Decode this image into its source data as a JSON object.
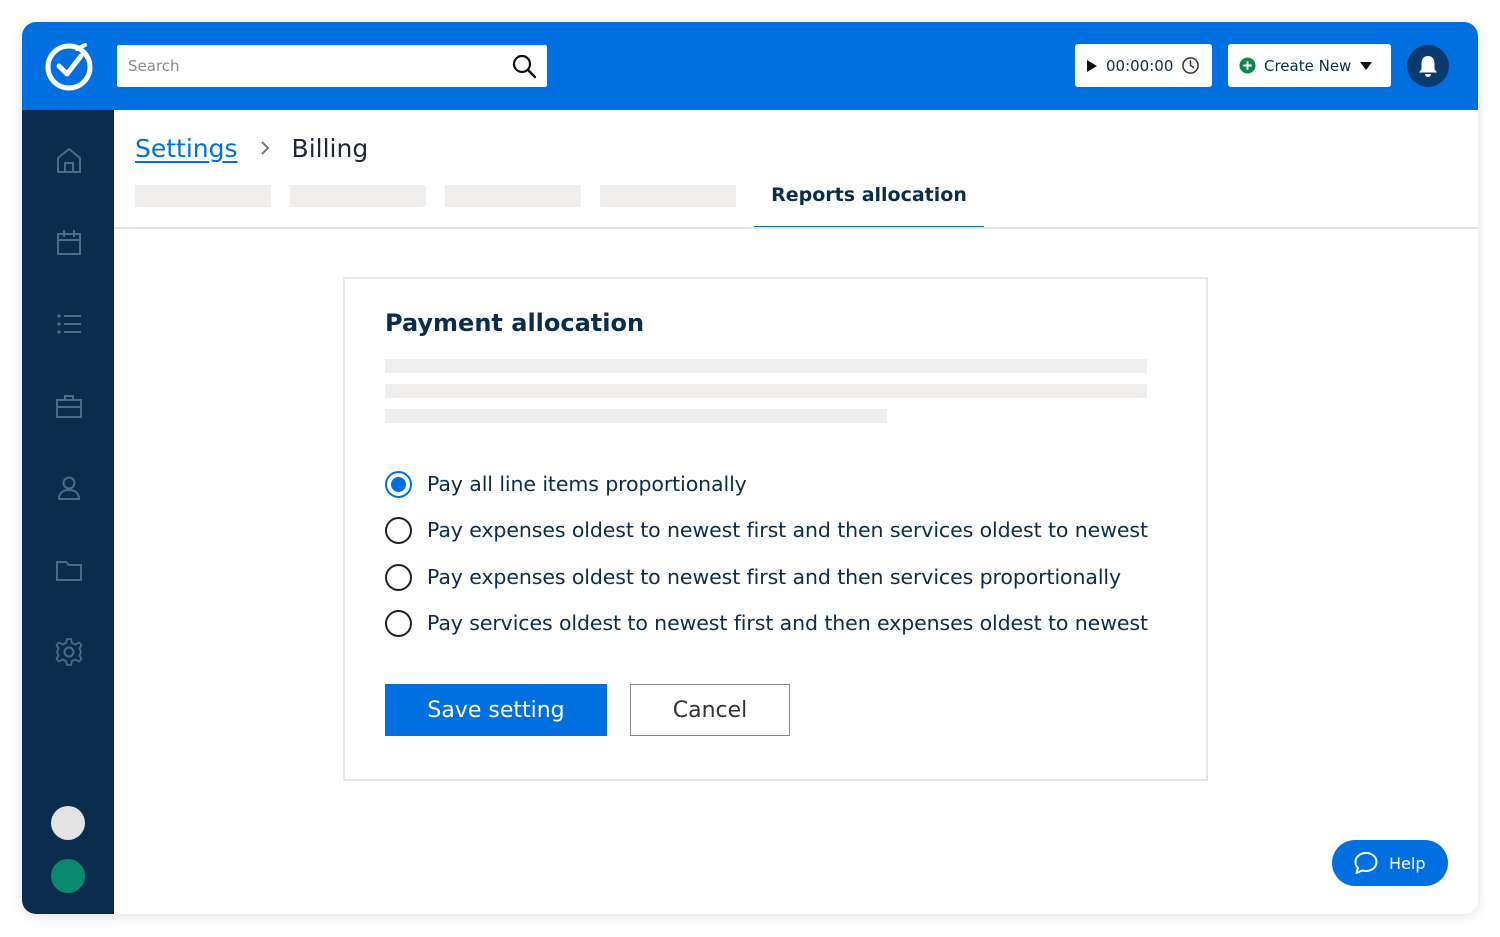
{
  "header": {
    "search_placeholder": "Search",
    "timer_value": "00:00:00",
    "create_new_label": "Create New"
  },
  "sidebar": {
    "items": [
      {
        "icon": "home-icon"
      },
      {
        "icon": "calendar-icon"
      },
      {
        "icon": "list-icon"
      },
      {
        "icon": "briefcase-icon"
      },
      {
        "icon": "person-icon"
      },
      {
        "icon": "folder-icon"
      },
      {
        "icon": "gear-icon"
      }
    ]
  },
  "breadcrumb": {
    "parent": "Settings",
    "current": "Billing"
  },
  "tabs": {
    "active_label": "Reports allocation"
  },
  "card": {
    "title": "Payment allocation",
    "options": [
      {
        "label": "Pay all line items proportionally",
        "checked": true
      },
      {
        "label": "Pay expenses oldest to newest first and then services oldest to newest",
        "checked": false
      },
      {
        "label": "Pay expenses oldest to newest first and then services proportionally",
        "checked": false
      },
      {
        "label": "Pay services oldest to newest first and then expenses oldest to newest",
        "checked": false
      }
    ],
    "save_label": "Save setting",
    "cancel_label": "Cancel"
  },
  "help": {
    "label": "Help"
  },
  "colors": {
    "brand_blue": "#0070e0",
    "sidebar_navy": "#0b2d4d",
    "success_green": "#0a8a6e"
  }
}
